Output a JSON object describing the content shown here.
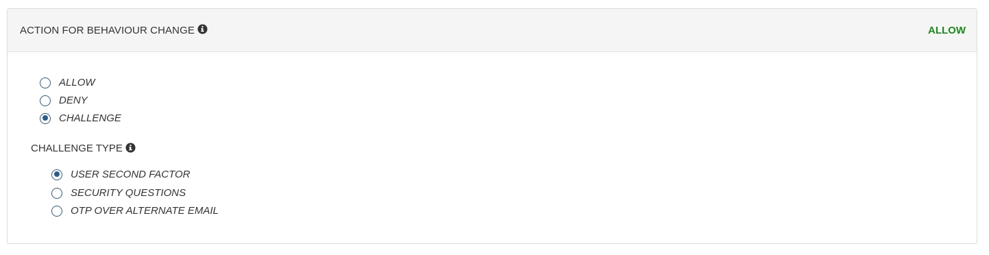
{
  "panel": {
    "title": "ACTION FOR BEHAVIOUR CHANGE",
    "status": "ALLOW",
    "status_color": "#1a8a1a",
    "info_icon": "info-circle-icon"
  },
  "action_options": [
    {
      "label": "ALLOW",
      "checked": false
    },
    {
      "label": "DENY",
      "checked": false
    },
    {
      "label": "CHALLENGE",
      "checked": true
    }
  ],
  "challenge_type": {
    "title": "CHALLENGE TYPE",
    "info_icon": "info-circle-icon",
    "options": [
      {
        "label": "USER SECOND FACTOR",
        "checked": true
      },
      {
        "label": "SECURITY QUESTIONS",
        "checked": false
      },
      {
        "label": "OTP OVER ALTERNATE EMAIL",
        "checked": false
      }
    ]
  },
  "colors": {
    "radio_accent": "#2c5d8a"
  }
}
